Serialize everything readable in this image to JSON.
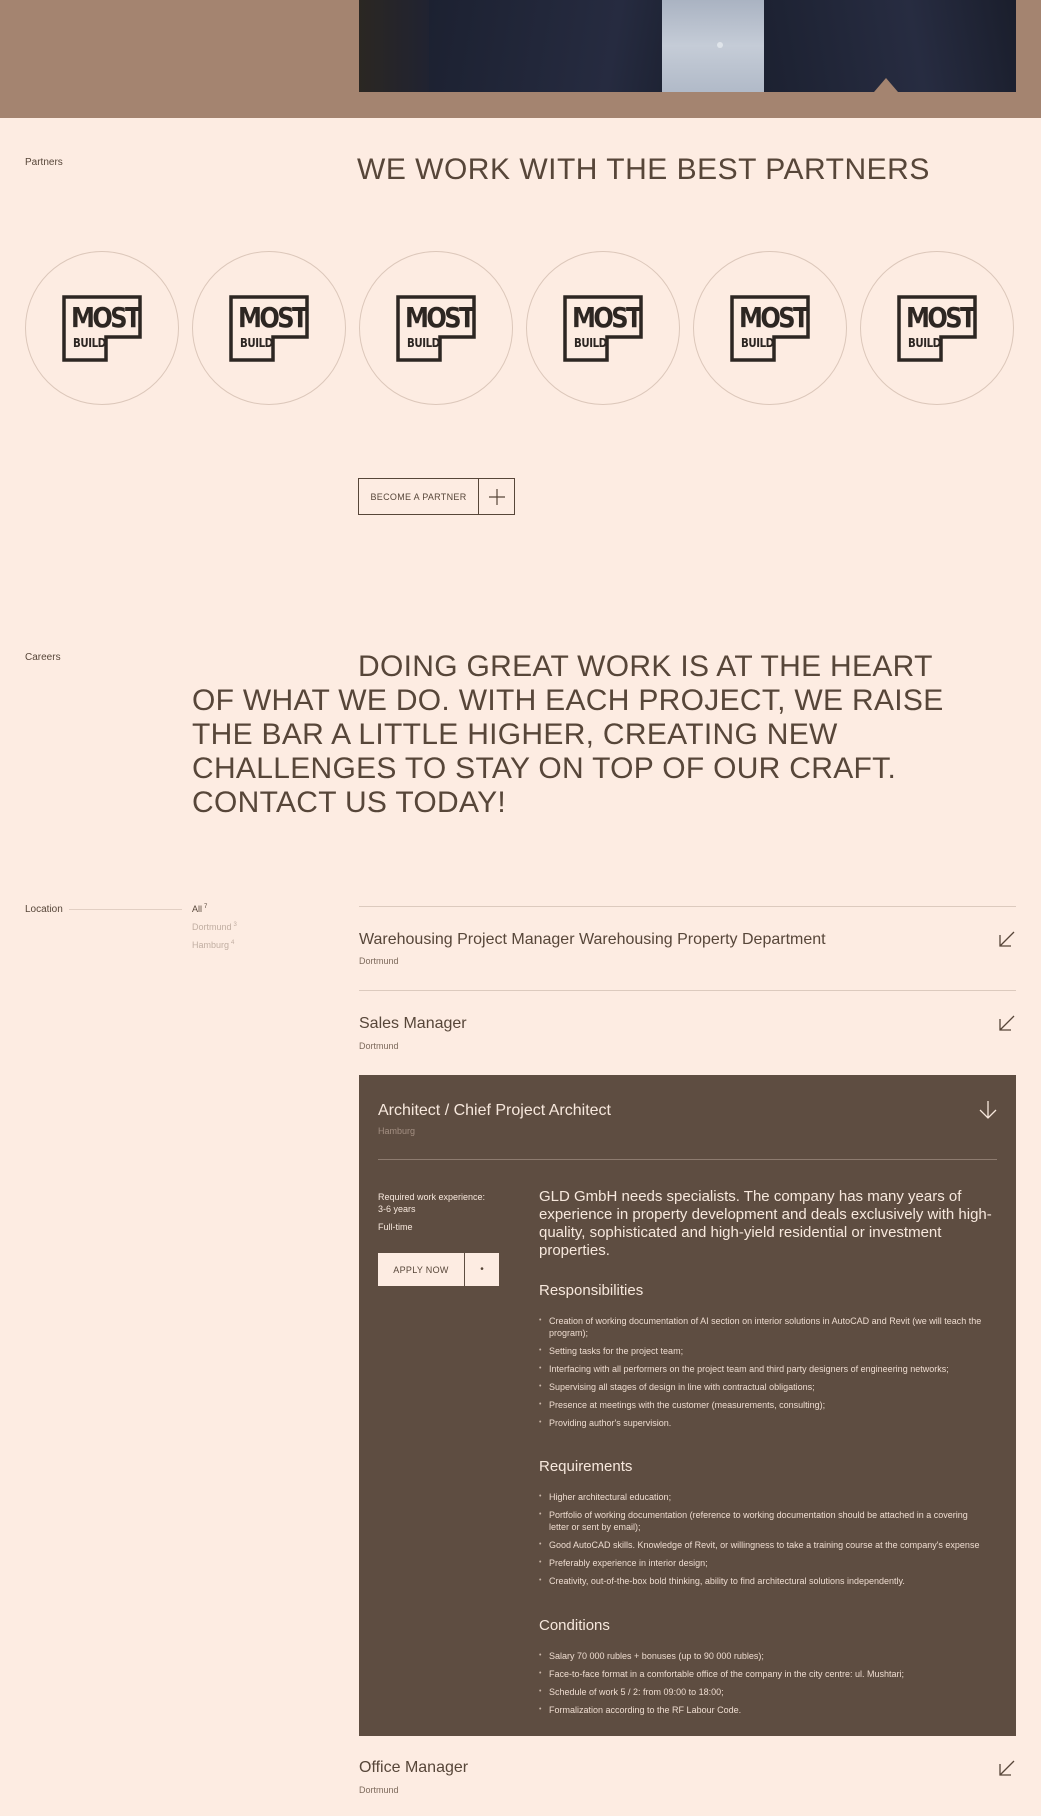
{
  "partners": {
    "label": "Partners",
    "heading": "WE WORK WITH THE BEST PARTNERS",
    "logos": [
      {
        "main": "MOST",
        "sub": "BUILD"
      },
      {
        "main": "MOST",
        "sub": "BUILD"
      },
      {
        "main": "MOST",
        "sub": "BUILD"
      },
      {
        "main": "MOST",
        "sub": "BUILD"
      },
      {
        "main": "MOST",
        "sub": "BUILD"
      },
      {
        "main": "MOST",
        "sub": "BUILD"
      }
    ],
    "button_label": "BECOME A PARTNER",
    "button_icon": "plus-icon"
  },
  "careers": {
    "label": "Careers",
    "text": "DOING GREAT WORK IS AT THE HEART OF WHAT WE DO. WITH EACH PROJECT, WE RAISE THE BAR A LITTLE HIGHER, CREATING NEW CHALLENGES TO STAY ON TOP OF OUR CRAFT. CONTACT US TODAY!"
  },
  "filters": {
    "label": "Location",
    "options": [
      {
        "name": "All",
        "count": "7",
        "active": true
      },
      {
        "name": "Dortmund",
        "count": "3",
        "active": false
      },
      {
        "name": "Hamburg",
        "count": "4",
        "active": false
      }
    ]
  },
  "jobs": [
    {
      "title": "Warehousing Project Manager Warehousing Property Department",
      "city": "Dortmund"
    },
    {
      "title": "Sales Manager",
      "city": "Dortmund"
    },
    {
      "title": "Office Manager",
      "city": "Dortmund"
    }
  ],
  "expanded": {
    "title": "Architect / Chief Project Architect",
    "city": "Hamburg",
    "experience_label": "Required work experience:",
    "experience_value": "3-6 years",
    "employment": "Full-time",
    "apply_label": "APPLY NOW",
    "apply_icon": "•",
    "intro": "GLD GmbH needs specialists. The company has many years of experience in property development and deals exclusively with high-quality, sophisticated and high-yield residential or investment properties.",
    "responsibilities_title": "Responsibilities",
    "responsibilities": [
      "Creation of working documentation of AI section on interior solutions in AutoCAD and Revit (we will teach the program);",
      "Setting tasks for the project team;",
      "Interfacing with all performers on the project team and third party designers of engineering networks;",
      "Supervising all stages of design in line with contractual obligations;",
      "Presence at meetings with the customer (measurements, consulting);",
      "Providing author's supervision."
    ],
    "requirements_title": "Requirements",
    "requirements": [
      "Higher architectural education;",
      "Portfolio of working documentation (reference to working documentation should be attached in a covering letter or sent by email);",
      "Good AutoCAD skills. Knowledge of Revit, or willingness to take a training course at the company's expense",
      "Preferably experience in interior design;",
      "Creativity, out-of-the-box bold thinking, ability to find architectural solutions independently."
    ],
    "conditions_title": "Conditions",
    "conditions": [
      "Salary 70 000 rubles + bonuses (up to 90 000 rubles);",
      "Face-to-face format in a comfortable office of the company in the city centre: ul. Mushtari;",
      "Schedule of work 5 / 2: from 09:00 to 18:00;",
      "Formalization according to the RF Labour Code."
    ]
  },
  "colors": {
    "background": "#fdece2",
    "hero": "#a48470",
    "text": "#574639",
    "card": "#5e4d41"
  }
}
